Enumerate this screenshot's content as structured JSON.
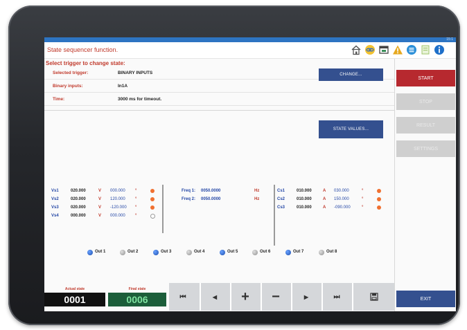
{
  "header": {
    "title": "State sequencer function.",
    "status_text": "15:1",
    "icons": [
      "home-icon",
      "link-icon",
      "window-icon",
      "warning-icon",
      "list-icon",
      "notes-icon",
      "info-icon"
    ]
  },
  "trigger": {
    "section_title": "Select trigger to change state:",
    "selected_trigger_label": "Selected trigger:",
    "selected_trigger_value": "BINARY INPUTS",
    "binary_inputs_label": "Binary inputs:",
    "binary_inputs_value": "In1A",
    "time_label": "Time:",
    "time_value": "3000 ms for timeout.",
    "change_button": "CHANGE..."
  },
  "state_values_button": "STATE VALUES...",
  "voltages": [
    {
      "name": "Vs1",
      "mag": "020.000",
      "unit": "V",
      "phase": "000.000",
      "deg": "°",
      "active": true
    },
    {
      "name": "Vs2",
      "mag": "020.000",
      "unit": "V",
      "phase": "120.000",
      "deg": "°",
      "active": true
    },
    {
      "name": "Vs3",
      "mag": "020.000",
      "unit": "V",
      "phase": "-120.000",
      "deg": "°",
      "active": true
    },
    {
      "name": "Vs4",
      "mag": "000.000",
      "unit": "V",
      "phase": "000.000",
      "deg": "°",
      "active": false
    }
  ],
  "frequencies": [
    {
      "label": "Freq 1:",
      "value": "0050.0000",
      "unit": "Hz"
    },
    {
      "label": "Freq 2:",
      "value": "0050.0000",
      "unit": "Hz"
    }
  ],
  "currents": [
    {
      "name": "Cs1",
      "mag": "010.000",
      "unit": "A",
      "phase": "030.000",
      "deg": "°",
      "active": true
    },
    {
      "name": "Cs2",
      "mag": "010.000",
      "unit": "A",
      "phase": "150.000",
      "deg": "°",
      "active": true
    },
    {
      "name": "Cs3",
      "mag": "010.000",
      "unit": "A",
      "phase": "-090.000",
      "deg": "°",
      "active": true
    }
  ],
  "outputs": [
    {
      "label": "Out 1",
      "on": true
    },
    {
      "label": "Out 2",
      "on": false
    },
    {
      "label": "Out 3",
      "on": true
    },
    {
      "label": "Out 4",
      "on": false
    },
    {
      "label": "Out 5",
      "on": true
    },
    {
      "label": "Out 6",
      "on": false
    },
    {
      "label": "Out 7",
      "on": true
    },
    {
      "label": "Out 8",
      "on": false
    }
  ],
  "states": {
    "actual_label": "Actual state",
    "actual_value": "0001",
    "final_label": "Final state",
    "final_value": "0006"
  },
  "nav": {
    "first": "⏮",
    "prev": "◀",
    "add": "+",
    "remove": "−",
    "next": "▶",
    "last": "⏭",
    "save_icon": "save-icon"
  },
  "sidebar": {
    "start": "START",
    "stop": "STOP",
    "result": "RESULT",
    "settings": "SETTINGS",
    "exit": "EXIT"
  },
  "colors": {
    "accent_red": "#b7292f",
    "accent_blue": "#34508f",
    "status_bar": "#2d74c2",
    "final_state_bg": "#1c5e3a",
    "final_state_text": "#7fe3a0"
  }
}
